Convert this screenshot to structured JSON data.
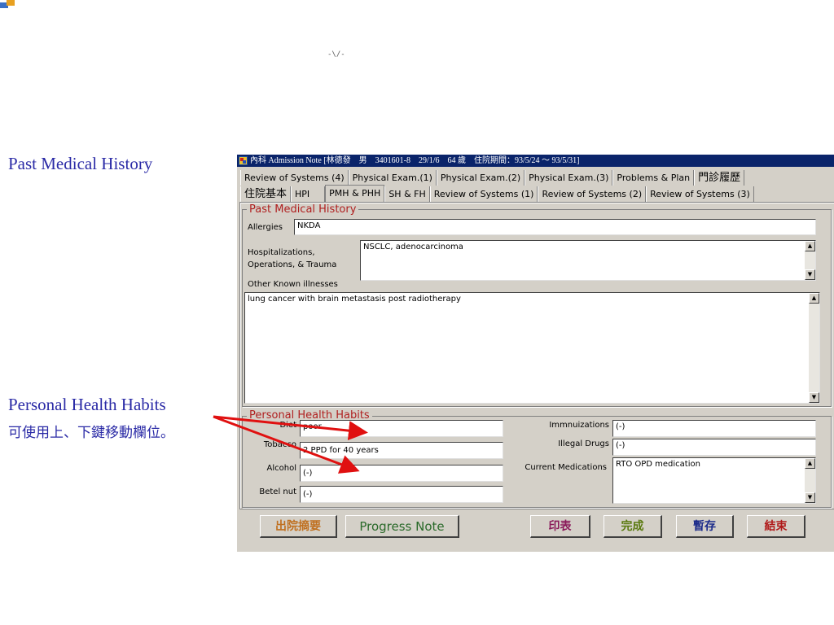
{
  "captions": {
    "pmh": "Past Medical History",
    "phh": "Personal Health Habits",
    "hint": "可使用上、下鍵移動欄位。"
  },
  "mark": "-\\/-",
  "window": {
    "title": "內科 Admission Note [林德發　男　3401601-8　29/1/6　64 歲　住院期間：93/5/24 ～ 93/5/31]"
  },
  "tabs_row1": [
    "Review of Systems (4)",
    "Physical Exam.(1)",
    "Physical Exam.(2)",
    "Physical Exam.(3)",
    "Problems & Plan",
    "門診履歷"
  ],
  "tabs_row2": [
    "住院基本",
    "HPI",
    "PMH & PHH",
    "SH & FH",
    "Review of Systems (1)",
    "Review of Systems (2)",
    "Review of Systems (3)"
  ],
  "active_tab": "PMH & PHH",
  "pmh": {
    "legend": "Past Medical History",
    "allergies_label": "Allergies",
    "allergies_value": "NKDA",
    "hosp_label_1": "Hospitalizations,",
    "hosp_label_2": "Operations, & Trauma",
    "hosp_value": "NSCLC, adenocarcinoma",
    "other_label": "Other Known illnesses",
    "other_value": "lung cancer with brain metastasis post radiotherapy"
  },
  "phh": {
    "legend": "Personal Health Habits",
    "diet_label": "Diet",
    "diet_value": "poor",
    "tobacco_label": "Tobacco",
    "tobacco_value": "2 PPD for 40 years",
    "alcohol_label": "Alcohol",
    "alcohol_value": "(-)",
    "betel_label": "Betel nut",
    "betel_value": "(-)",
    "immun_label": "Immnuizations",
    "immun_value": "(-)",
    "drugs_label": "Illegal Drugs",
    "drugs_value": "(-)",
    "meds_label": "Current Medications",
    "meds_value": "RTO OPD medication"
  },
  "buttons": {
    "summary": "出院摘要",
    "progress": "Progress Note",
    "print": "印表",
    "done": "完成",
    "save": "暫存",
    "end": "結束"
  },
  "colors": {
    "caption": "#2a2aa6",
    "titlebar": "#0a246a",
    "legend": "#b02020",
    "arrow": "#e01010",
    "window_bg": "#d4d0c8"
  }
}
